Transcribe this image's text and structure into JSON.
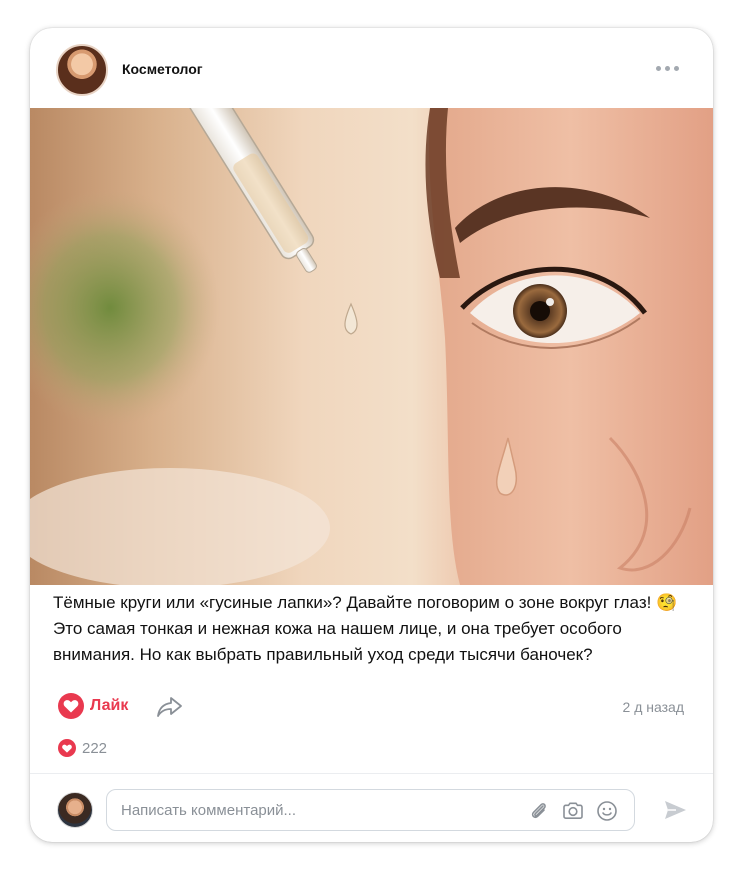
{
  "post": {
    "author": "Косметолог",
    "text": "Тёмные круги или «гусиные лапки»? Давайте поговорим о зоне вокруг глаз! 🧐 Это самая тонкая и нежная кожа на нашем лице, и она требует особого внимания. Но как выбрать правильный уход среди тысячи баночек?",
    "timestamp": "2 д назад"
  },
  "actions": {
    "like_label": "Лайк",
    "likes_count": "222"
  },
  "comment": {
    "placeholder": "Написать комментарий..."
  },
  "icons": {
    "more": "more-horizontal-icon",
    "like": "heart-icon",
    "share": "share-arrow-icon",
    "attach": "paperclip-icon",
    "camera": "camera-icon",
    "emoji": "smile-icon",
    "send": "send-icon"
  },
  "colors": {
    "accent": "#e9394f",
    "muted_text": "#8a9097",
    "icon_gray": "#a3a9b0",
    "border": "#d3d9df"
  }
}
